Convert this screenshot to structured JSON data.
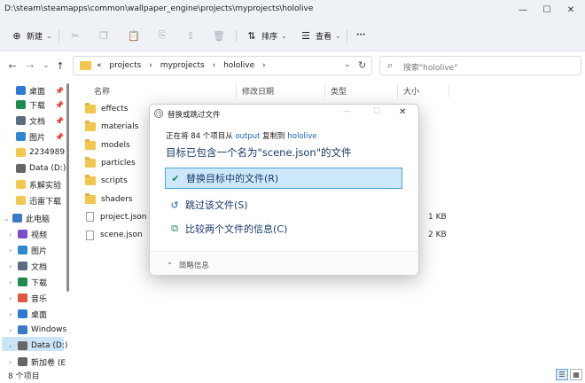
{
  "titlebar": {
    "path": "D:\\steam\\steamapps\\common\\wallpaper_engine\\projects\\myprojects\\hololive",
    "minimize": "—",
    "maximize": "☐",
    "close": "✕"
  },
  "toolbar": {
    "new_label": "新建",
    "sort_label": "排序",
    "view_label": "查看",
    "more_label": "···"
  },
  "nav": {
    "back": "←",
    "forward": "→",
    "down": "⌄",
    "up": "↑",
    "breadcrumbs": [
      "«",
      "projects",
      "›",
      "myprojects",
      "›",
      "hololive",
      "›"
    ],
    "search_placeholder": "搜索\"hololive\""
  },
  "sidebar": {
    "items": [
      {
        "label": "桌面",
        "icon": "desktop-icon",
        "color": "#2e7bd6",
        "pinned": true
      },
      {
        "label": "下载",
        "icon": "download-icon",
        "color": "#1f8a4d",
        "pinned": true
      },
      {
        "label": "文档",
        "icon": "documents-icon",
        "color": "#5b6b80",
        "pinned": true
      },
      {
        "label": "图片",
        "icon": "pictures-icon",
        "color": "#2f86d1",
        "pinned": true
      },
      {
        "label": "2234989",
        "icon": "folder-icon",
        "color": "#f3c64d",
        "pinned": false
      },
      {
        "label": "Data (D:)",
        "icon": "drive-icon",
        "color": "#666666",
        "pinned": false
      },
      {
        "label": "系解实验",
        "icon": "folder-icon",
        "color": "#f3c64d",
        "pinned": false
      },
      {
        "label": "迅雷下载",
        "icon": "folder-icon",
        "color": "#f3c64d",
        "pinned": false
      },
      {
        "label": "此电脑",
        "icon": "computer-icon",
        "color": "#3a7bc8",
        "pinned": false
      },
      {
        "label": "视频",
        "icon": "videos-icon",
        "color": "#7a4fc9",
        "pinned": false
      },
      {
        "label": "图片",
        "icon": "pictures-icon",
        "color": "#2f86d1",
        "pinned": false
      },
      {
        "label": "文档",
        "icon": "documents-icon",
        "color": "#5b6b80",
        "pinned": false
      },
      {
        "label": "下载",
        "icon": "download-icon",
        "color": "#1f8a4d",
        "pinned": false
      },
      {
        "label": "音乐",
        "icon": "music-icon",
        "color": "#e0573c",
        "pinned": false
      },
      {
        "label": "桌面",
        "icon": "desktop-icon",
        "color": "#2e7bd6",
        "pinned": false
      },
      {
        "label": "Windows",
        "icon": "drive-icon",
        "color": "#3a7bc8",
        "pinned": false
      },
      {
        "label": "Data (D:)",
        "icon": "drive-icon",
        "color": "#666666",
        "pinned": false
      },
      {
        "label": "新加卷 (E",
        "icon": "drive-icon",
        "color": "#666666",
        "pinned": false
      }
    ]
  },
  "list": {
    "columns": [
      "名称",
      "修改日期",
      "类型",
      "大小"
    ],
    "rows": [
      {
        "name": "effects",
        "kind": "folder",
        "size": ""
      },
      {
        "name": "materials",
        "kind": "folder",
        "size": ""
      },
      {
        "name": "models",
        "kind": "folder",
        "size": ""
      },
      {
        "name": "particles",
        "kind": "folder",
        "size": ""
      },
      {
        "name": "scripts",
        "kind": "folder",
        "size": ""
      },
      {
        "name": "shaders",
        "kind": "folder",
        "size": ""
      },
      {
        "name": "project.json",
        "kind": "file",
        "size": "1 KB"
      },
      {
        "name": "scene.json",
        "kind": "file",
        "size": "2 KB"
      }
    ]
  },
  "status": {
    "count": "8 个项目"
  },
  "dialog": {
    "title": "替换或跳过文件",
    "copy_prefix": "正在将 84 个项目从 ",
    "copy_src": "output",
    "copy_mid": " 复制到 ",
    "copy_dst": "hololive",
    "heading": "目标已包含一个名为\"scene.json\"的文件",
    "options": [
      {
        "label": "替换目标中的文件(R)",
        "icon": "✔",
        "icon_color": "#1f8a4d"
      },
      {
        "label": "跳过该文件(S)",
        "icon": "↺",
        "icon_color": "#1a5fb4"
      },
      {
        "label": "比较两个文件的信息(C)",
        "icon": "⧉",
        "icon_color": "#1f8a4d"
      }
    ],
    "footer": "简略信息",
    "footer_icon": "⌃"
  },
  "colors": {
    "accent": "#4aa3df",
    "link": "#1a5fb4",
    "folder": "#f3c64d"
  }
}
